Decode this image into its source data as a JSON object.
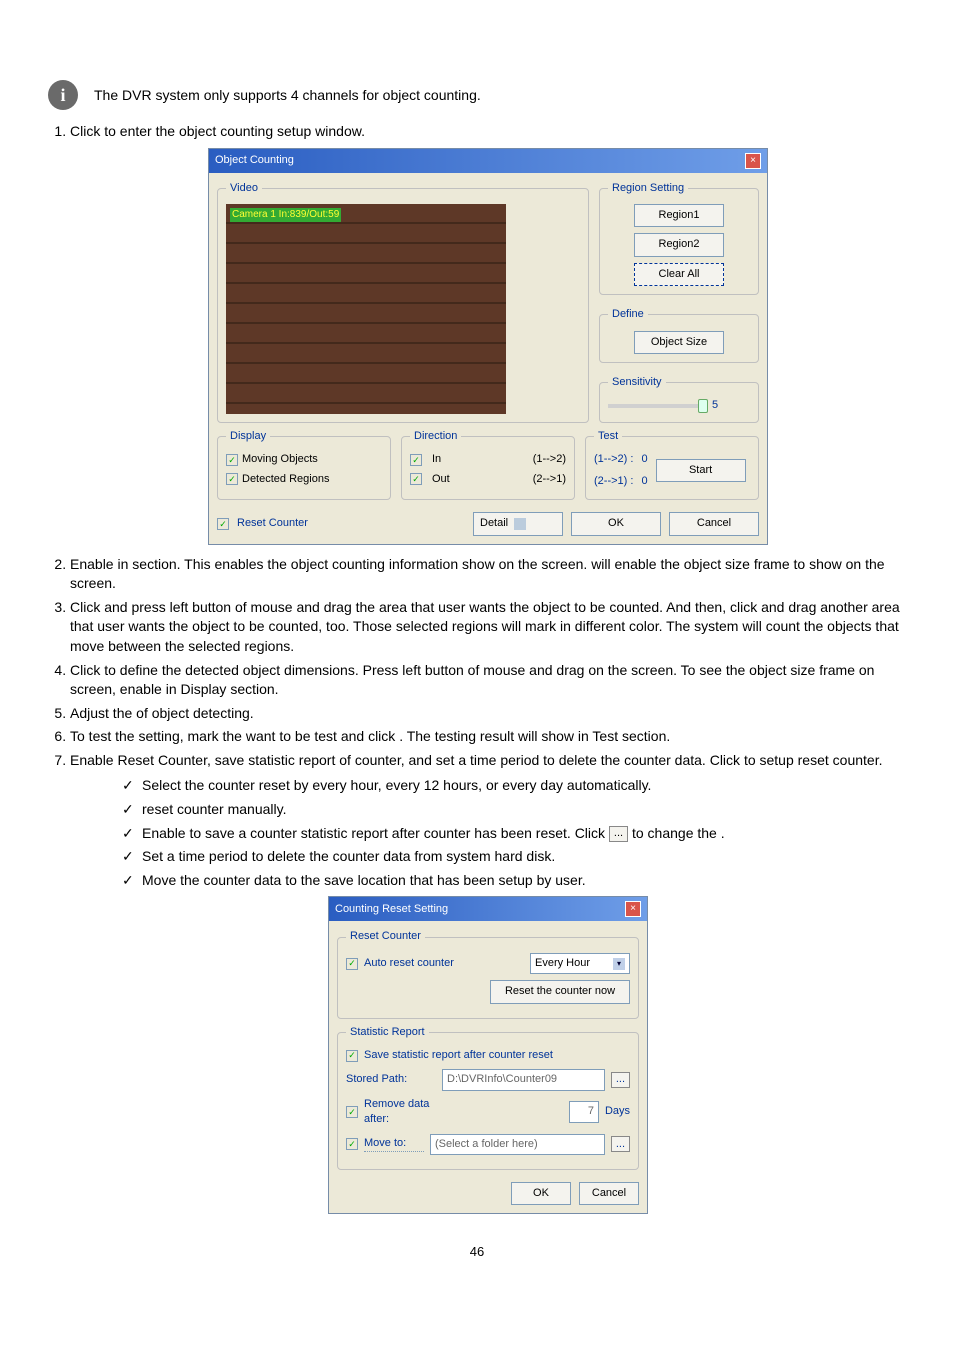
{
  "info_note": "The DVR system only supports 4 channels for object counting.",
  "steps": {
    "s1_a": "Click ",
    "s1_b": " to enter the object counting setup window.",
    "s2_a": "Enable ",
    "s2_b": " in ",
    "s2_c": " section. This enables the object counting information show on the screen. ",
    "s2_d": " will enable the object size frame to show on the screen.",
    "s3_a": "Click ",
    "s3_b": " and press left button of mouse and drag the area that user wants the object to be counted. And then, click ",
    "s3_c": " and drag another area that user wants the object to be counted, too. Those selected regions will mark in different color. The system will count the objects that move between the selected regions.",
    "s4_a": "Click ",
    "s4_b": " to define the detected object dimensions. Press left button of mouse and drag on the screen. To see the object size frame on screen, enable ",
    "s4_c": " in Display section.",
    "s5_a": "Adjust the ",
    "s5_b": " of object detecting.",
    "s6_a": "To test the setting, mark the ",
    "s6_b": " want to be test and click ",
    "s6_c": ". The testing result will show in Test section.",
    "s7_a": "Enable Reset Counter, save statistic report of counter, and set a time period to delete the counter data. Click ",
    "s7_b": " to setup reset counter."
  },
  "sub": {
    "a1": " Select the counter reset by every hour, every 12 hours, or every day automatically.",
    "b1": " reset counter manually.",
    "c1": " Enable to save a counter statistic report after counter has been reset. Click ",
    "c2": " to change the ",
    "c3": ".",
    "d1": " Set a time period to delete the counter data from system hard disk.",
    "e1": " Move the counter data to the save location that has been setup by user."
  },
  "obj_dlg": {
    "title": "Object Counting",
    "video_legend": "Video",
    "video_overlay": "Camera 1 In:839/Out:59",
    "region_legend": "Region Setting",
    "region1": "Region1",
    "region2": "Region2",
    "clear_all": "Clear All",
    "define_legend": "Define",
    "object_size": "Object Size",
    "sensitivity_legend": "Sensitivity",
    "sensitivity_value": "5",
    "display_legend": "Display",
    "moving_objects": "Moving Objects",
    "detected_regions": "Detected Regions",
    "direction_legend": "Direction",
    "dir_in": "In",
    "dir_in_arrow": "(1-->2)",
    "dir_out": "Out",
    "dir_out_arrow": "(2-->1)",
    "test_legend": "Test",
    "test_12": "(1-->2) :",
    "test_21": "(2-->1) :",
    "test_v1": "0",
    "test_v2": "0",
    "start": "Start",
    "reset_counter": "Reset Counter",
    "detail": "Detail",
    "ok": "OK",
    "cancel": "Cancel"
  },
  "crs_dlg": {
    "title": "Counting Reset Setting",
    "reset_legend": "Reset Counter",
    "auto_reset": "Auto reset counter",
    "interval": "Every Hour",
    "reset_now": "Reset the counter now",
    "stat_legend": "Statistic Report",
    "save_after": "Save statistic report after counter reset",
    "stored_path_lbl": "Stored Path:",
    "stored_path_val": "D:\\DVRInfo\\Counter09",
    "remove_after_lbl": "Remove data after:",
    "remove_after_val": "7",
    "days": "Days",
    "move_to": "Move to:",
    "move_to_val": "(Select a folder here)",
    "ok": "OK",
    "cancel": "Cancel"
  },
  "ellipsis": "...",
  "page_number": "46"
}
